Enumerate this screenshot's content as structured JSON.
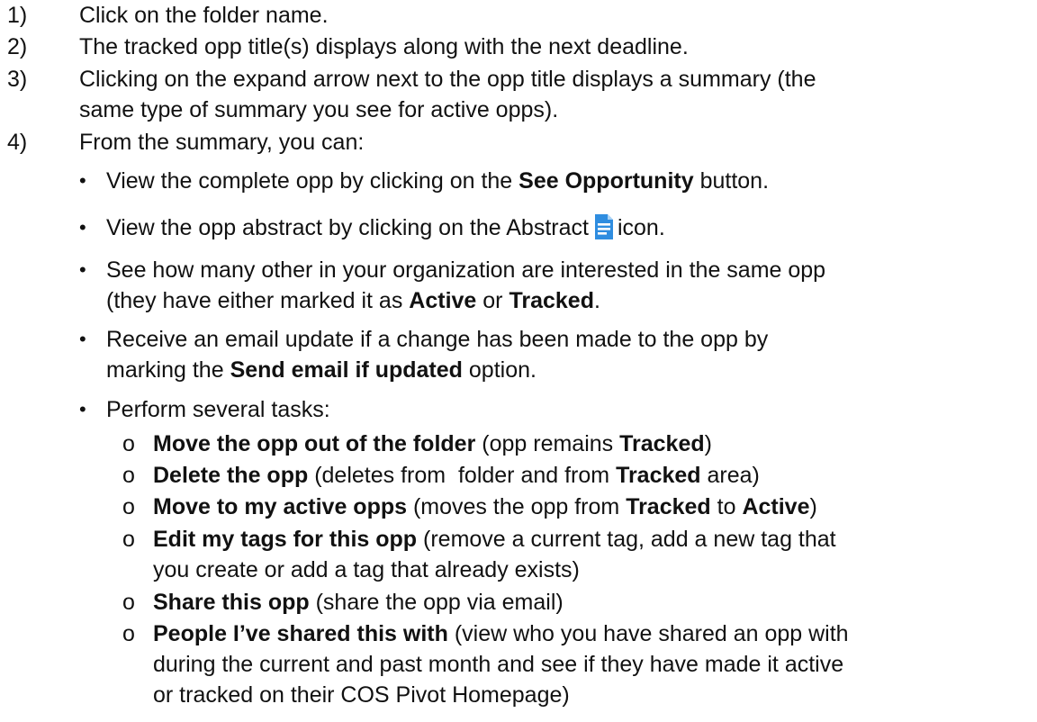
{
  "steps": [
    {
      "num": "1)",
      "text": "Click on the folder name."
    },
    {
      "num": "2)",
      "text": "The tracked opp title(s) displays along with the next deadline."
    },
    {
      "num": "3)",
      "line1": "Clicking on the expand arrow next to the opp title displays a summary (the",
      "line2": "same type of summary you see for active opps)."
    },
    {
      "num": "4)",
      "text": "From the summary, you can:"
    }
  ],
  "bullets": {
    "b1": {
      "pre": "View the complete opp by clicking on the ",
      "bold": "See Opportunity",
      "post": " button."
    },
    "b2": {
      "pre": "View the opp abstract by clicking on the Abstract",
      "post": "icon.",
      "icon": "document-icon",
      "icon_color": "#2f8de0"
    },
    "b3": {
      "line1": "See how many other in your organization are interested in the same opp",
      "line2_pre": "(they have either marked it as ",
      "bold1": "Active",
      "mid": " or ",
      "bold2": "Tracked",
      "end": "."
    },
    "b4": {
      "line1": "Receive an email update if a change has been made to the opp by",
      "line2_pre": "marking the ",
      "bold": "Send email if updated",
      "post": " option."
    },
    "b5": {
      "text": "Perform several tasks:"
    }
  },
  "tasks": [
    {
      "bold": "Move the opp out of the folder",
      "pre": " (opp remains ",
      "bold2": "Tracked",
      "post": ")"
    },
    {
      "bold": "Delete the opp",
      "pre": " (deletes from  folder and from ",
      "bold2": "Tracked",
      "post": " area)"
    },
    {
      "bold": "Move to my active opps",
      "pre": " (moves the opp from ",
      "bold2": "Tracked",
      "mid": " to ",
      "bold3": "Active",
      "post": ")"
    },
    {
      "bold": "Edit my tags for this opp",
      "line1": " (remove a current tag, add a new tag that",
      "line2": "you create or add a tag that already exists)"
    },
    {
      "bold": "Share this opp",
      "post": " (share the opp via email)"
    },
    {
      "bold": "People I’ve shared this with",
      "line1": " (view who you have shared an opp with",
      "line2": "during the current and past month and see if they have made it active",
      "line3": "or tracked on their COS Pivot Homepage)"
    }
  ],
  "markers": {
    "bullet": "•",
    "circle": "o"
  }
}
